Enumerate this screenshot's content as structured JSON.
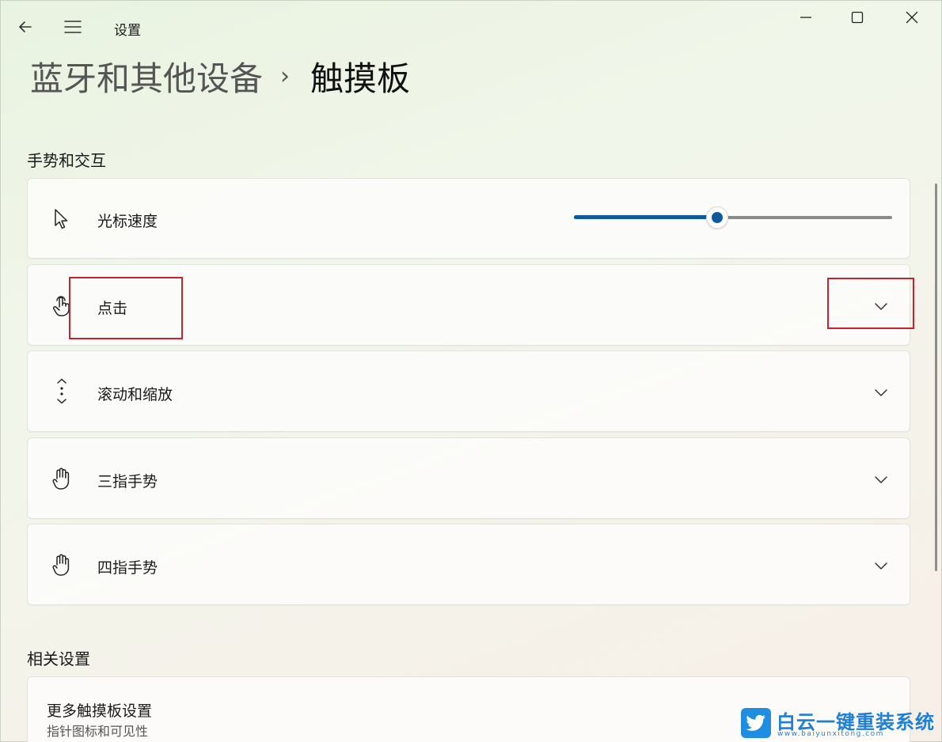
{
  "window": {
    "app_title": "设置"
  },
  "breadcrumb": {
    "parent": "蓝牙和其他设备",
    "separator": "›",
    "current": "触摸板"
  },
  "sections": {
    "gestures_title": "手势和交互",
    "related_title": "相关设置"
  },
  "settings": {
    "cursor_speed": {
      "label": "光标速度",
      "icon": "cursor-arrow-icon",
      "slider_fraction": 0.45
    },
    "tap": {
      "label": "点击",
      "icon": "tap-hand-icon"
    },
    "scroll_zoom": {
      "label": "滚动和缩放",
      "icon": "scroll-arrows-icon"
    },
    "three_finger": {
      "label": "三指手势",
      "icon": "hand-icon"
    },
    "four_finger": {
      "label": "四指手势",
      "icon": "hand-icon"
    }
  },
  "related": {
    "more_touchpad": {
      "title": "更多触摸板设置",
      "subtitle": "指针图标和可见性"
    }
  },
  "watermark": {
    "name": "白云一键重装系统",
    "url": "www.baiyunxitong.com"
  },
  "colors": {
    "accent": "#0f5a9e",
    "highlight_box": "#c9222e",
    "watermark": "#1e7fd6"
  }
}
